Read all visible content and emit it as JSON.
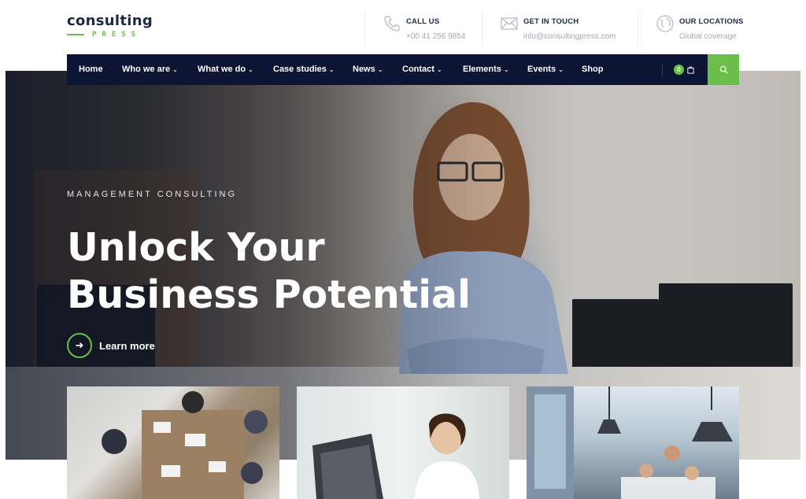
{
  "brand": {
    "name": "consulting",
    "sub": "PRESS",
    "accent_color": "#6abf4b",
    "navy_color": "#0c1533"
  },
  "header_info": [
    {
      "icon": "phone-icon",
      "title": "CALL US",
      "value": "+00 41 256 9854"
    },
    {
      "icon": "envelope-icon",
      "title": "GET IN TOUCH",
      "value": "info@consultingpress.com"
    },
    {
      "icon": "globe-icon",
      "title": "OUR LOCATIONS",
      "value": "Global coverage"
    }
  ],
  "nav": {
    "items": [
      {
        "label": "Home",
        "dropdown": false
      },
      {
        "label": "Who we are",
        "dropdown": true
      },
      {
        "label": "What we do",
        "dropdown": true
      },
      {
        "label": "Case studies",
        "dropdown": true
      },
      {
        "label": "News",
        "dropdown": true
      },
      {
        "label": "Contact",
        "dropdown": true
      },
      {
        "label": "Elements",
        "dropdown": true
      },
      {
        "label": "Events",
        "dropdown": true
      },
      {
        "label": "Shop",
        "dropdown": false
      }
    ],
    "cart_count": "0",
    "search_icon": "search-icon",
    "cart_icon": "shopping-bag-icon"
  },
  "hero": {
    "kicker": "MANAGEMENT CONSULTING",
    "title_line1": "Unlock Your",
    "title_line2": "Business Potential",
    "cta_label": "Learn more",
    "cta_icon": "arrow-right-icon"
  },
  "cards": [
    {
      "image": "team-meeting-photo"
    },
    {
      "image": "woman-at-computer-photo"
    },
    {
      "image": "office-teamwork-photo"
    }
  ]
}
